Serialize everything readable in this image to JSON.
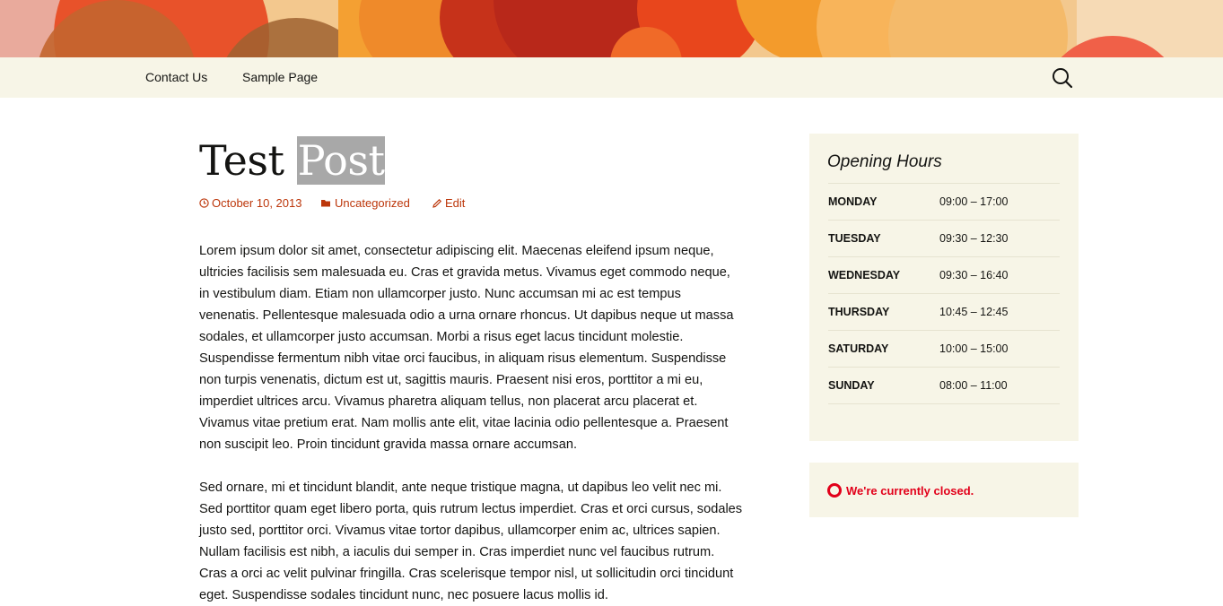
{
  "nav": {
    "items": [
      "Contact Us",
      "Sample Page"
    ],
    "search_icon": "search-icon"
  },
  "post": {
    "title_part1": "Test",
    "title_part2": "Post",
    "date": "October 10, 2013",
    "category": "Uncategorized",
    "edit": "Edit",
    "paragraphs": [
      "Lorem ipsum dolor sit amet, consectetur adipiscing elit. Maecenas eleifend ipsum neque, ultricies facilisis sem malesuada eu. Cras et gravida metus. Vivamus eget commodo neque, in vestibulum diam. Etiam non ullamcorper justo. Nunc accumsan mi ac est tempus venenatis. Pellentesque malesuada odio a urna ornare rhoncus. Ut dapibus neque ut massa sodales, et ullamcorper justo accumsan. Morbi a risus eget lacus tincidunt molestie. Suspendisse fermentum nibh vitae orci faucibus, in aliquam risus elementum. Suspendisse non turpis venenatis, dictum est ut, sagittis mauris. Praesent nisi eros, porttitor a mi eu, imperdiet ultrices arcu. Vivamus pharetra aliquam tellus, non placerat arcu placerat et. Vivamus vitae pretium erat. Nam mollis ante elit, vitae lacinia odio pellentesque a. Praesent non suscipit leo. Proin tincidunt gravida massa ornare accumsan.",
      "Sed ornare, mi et tincidunt blandit, ante neque tristique magna, ut dapibus leo velit nec mi. Sed porttitor quam eget libero porta, quis rutrum lectus imperdiet. Cras et orci cursus, sodales justo sed, porttitor orci. Vivamus vitae tortor dapibus, ullamcorper enim ac, ultrices sapien. Nullam facilisis est nibh, a iaculis dui semper in. Cras imperdiet nunc vel faucibus rutrum. Cras a orci ac velit pulvinar fringilla. Cras scelerisque tempor nisl, ut sollicitudin orci tincidunt eget. Suspendisse sodales tincidunt nunc, nec posuere lacus mollis id."
    ]
  },
  "sidebar": {
    "hours_title": "Opening Hours",
    "hours": [
      {
        "day": "MONDAY",
        "time": "09:00 – 17:00"
      },
      {
        "day": "TUESDAY",
        "time": "09:30 – 12:30"
      },
      {
        "day": "WEDNESDAY",
        "time": "09:30 – 16:40"
      },
      {
        "day": "THURSDAY",
        "time": "10:45 – 12:45"
      },
      {
        "day": "SATURDAY",
        "time": "10:00 – 15:00"
      },
      {
        "day": "SUNDAY",
        "time": "08:00 – 11:00"
      }
    ],
    "status": "We're currently closed."
  },
  "colors": {
    "accent": "#bc360a",
    "status": "#e2001a",
    "widget_bg": "#f7f5e7"
  }
}
